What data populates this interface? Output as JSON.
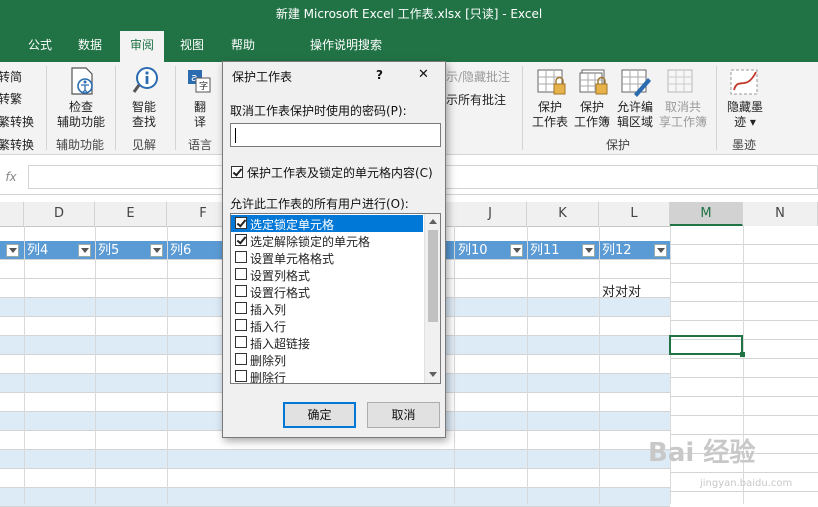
{
  "window": {
    "title": "新建 Microsoft Excel 工作表.xlsx  [只读]  -  Excel"
  },
  "tabs": [
    {
      "label": "公式"
    },
    {
      "label": "数据"
    },
    {
      "label": "审阅"
    },
    {
      "label": "视图"
    },
    {
      "label": "帮助"
    },
    {
      "label": "操作说明搜索"
    }
  ],
  "ribbon": {
    "chinese": {
      "items": [
        "转简",
        "转繁",
        "繁转换",
        "繁转换"
      ]
    },
    "accessibility": {
      "button": "检查\n辅助功能",
      "group": "辅助功能"
    },
    "insights": {
      "button": "智能\n查找",
      "group": "见解"
    },
    "language": {
      "button": "翻\n译",
      "group": "语言"
    },
    "comments": {
      "items": [
        "示/隐藏批注",
        "示所有批注"
      ]
    },
    "protect": {
      "buttons": [
        "保护\n工作表",
        "保护\n工作簿",
        "允许编\n辑区域",
        "取消共\n享工作簿"
      ],
      "group": "保护"
    },
    "ink": {
      "button": "隐藏墨\n迹 ▾",
      "group": "墨迹"
    }
  },
  "formula_bar": {
    "fx": "fx"
  },
  "columns": [
    "D",
    "E",
    "F",
    "J",
    "K",
    "L",
    "M",
    "N"
  ],
  "table_headers": [
    "列4",
    "列5",
    "列6",
    "列10",
    "列11",
    "列12"
  ],
  "cells": {
    "l1": "对对对"
  },
  "dialog": {
    "title": "保护工作表",
    "help": "?",
    "close": "✕",
    "password_label": "取消工作表保护时使用的密码(P):",
    "password_value": "",
    "protect_check": {
      "label": "保护工作表及锁定的单元格内容(C)",
      "checked": true
    },
    "allow_label": "允许此工作表的所有用户进行(O):",
    "permissions": [
      {
        "label": "选定锁定单元格",
        "checked": true,
        "selected": true
      },
      {
        "label": "选定解除锁定的单元格",
        "checked": true,
        "selected": false
      },
      {
        "label": "设置单元格格式",
        "checked": false,
        "selected": false
      },
      {
        "label": "设置列格式",
        "checked": false,
        "selected": false
      },
      {
        "label": "设置行格式",
        "checked": false,
        "selected": false
      },
      {
        "label": "插入列",
        "checked": false,
        "selected": false
      },
      {
        "label": "插入行",
        "checked": false,
        "selected": false
      },
      {
        "label": "插入超链接",
        "checked": false,
        "selected": false
      },
      {
        "label": "删除列",
        "checked": false,
        "selected": false
      },
      {
        "label": "删除行",
        "checked": false,
        "selected": false
      }
    ],
    "ok": "确定",
    "cancel": "取消"
  },
  "watermark": {
    "text": "Bai 经验",
    "sub": "jingyan.baidu.com"
  },
  "colors": {
    "excel_green": "#217346",
    "table_header": "#5b9bd5",
    "band": "#ddebf7",
    "selected": "#0078d7"
  }
}
